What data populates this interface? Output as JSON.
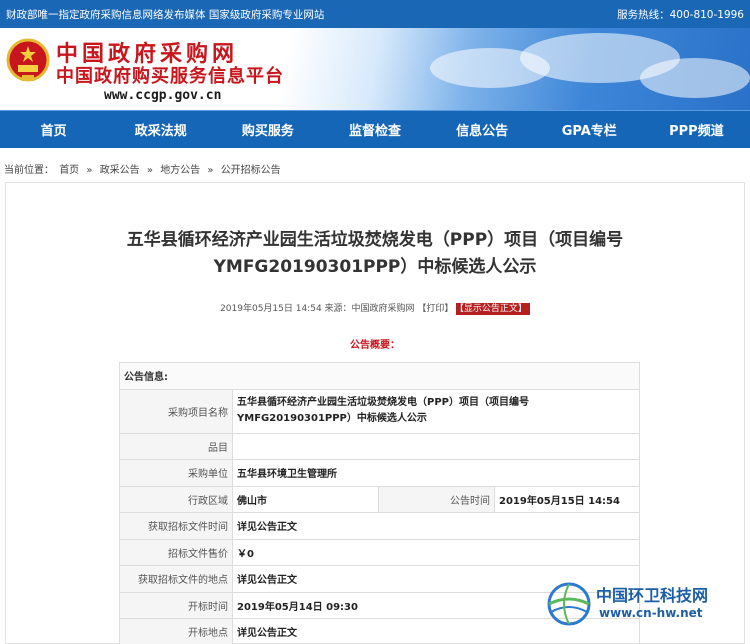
{
  "topbar": {
    "left": "财政部唯一指定政府采购信息网络发布媒体 国家级政府采购专业网站",
    "right": "服务热线：400-810-1996"
  },
  "header": {
    "logo_cn": "中国政府采购网",
    "logo_sub": "中国政府购买服务信息平台",
    "logo_url": "www.ccgp.gov.cn"
  },
  "nav": [
    "首页",
    "政采法规",
    "购买服务",
    "监督检查",
    "信息公告",
    "GPA专栏",
    "PPP频道"
  ],
  "breadcrumb": {
    "prefix": "当前位置：",
    "items": [
      "首页",
      "政采公告",
      "地方公告",
      "公开招标公告"
    ],
    "sep": "»"
  },
  "article": {
    "title_line1": "五华县循环经济产业园生活垃圾焚烧发电（PPP）项目（项目编号",
    "title_line2": "YMFG20190301PPP）中标候选人公示",
    "meta": "2019年05月15日 14:54 来源：中国政府采购网 【打印】",
    "show_body": "【显示公告正文】",
    "summary_label": "公告概要："
  },
  "info": {
    "header": "公告信息:",
    "project_name_label": "采购项目名称",
    "project_name_value": "五华县循环经济产业园生活垃圾焚烧发电（PPP）项目（项目编号YMFG20190301PPP）中标候选人公示",
    "category_label": "品目",
    "category_value": "",
    "purchaser_label": "采购单位",
    "purchaser_value": "五华县环境卫生管理所",
    "region_label": "行政区域",
    "region_value": "佛山市",
    "time_label": "公告时间",
    "time_value": "2019年05月15日 14:54",
    "get_time_label": "获取招标文件时间",
    "get_time_value": "详见公告正文",
    "price_label": "招标文件售价",
    "price_value": "￥0",
    "get_place_label": "获取招标文件的地点",
    "get_place_value": "详见公告正文",
    "open_time_label": "开标时间",
    "open_time_value": "2019年05月14日 09:30",
    "open_place_label": "开标地点",
    "open_place_value": "详见公告正文"
  },
  "watermark": {
    "cn": "中国环卫科技网",
    "url": "www.cn-hw.net"
  }
}
